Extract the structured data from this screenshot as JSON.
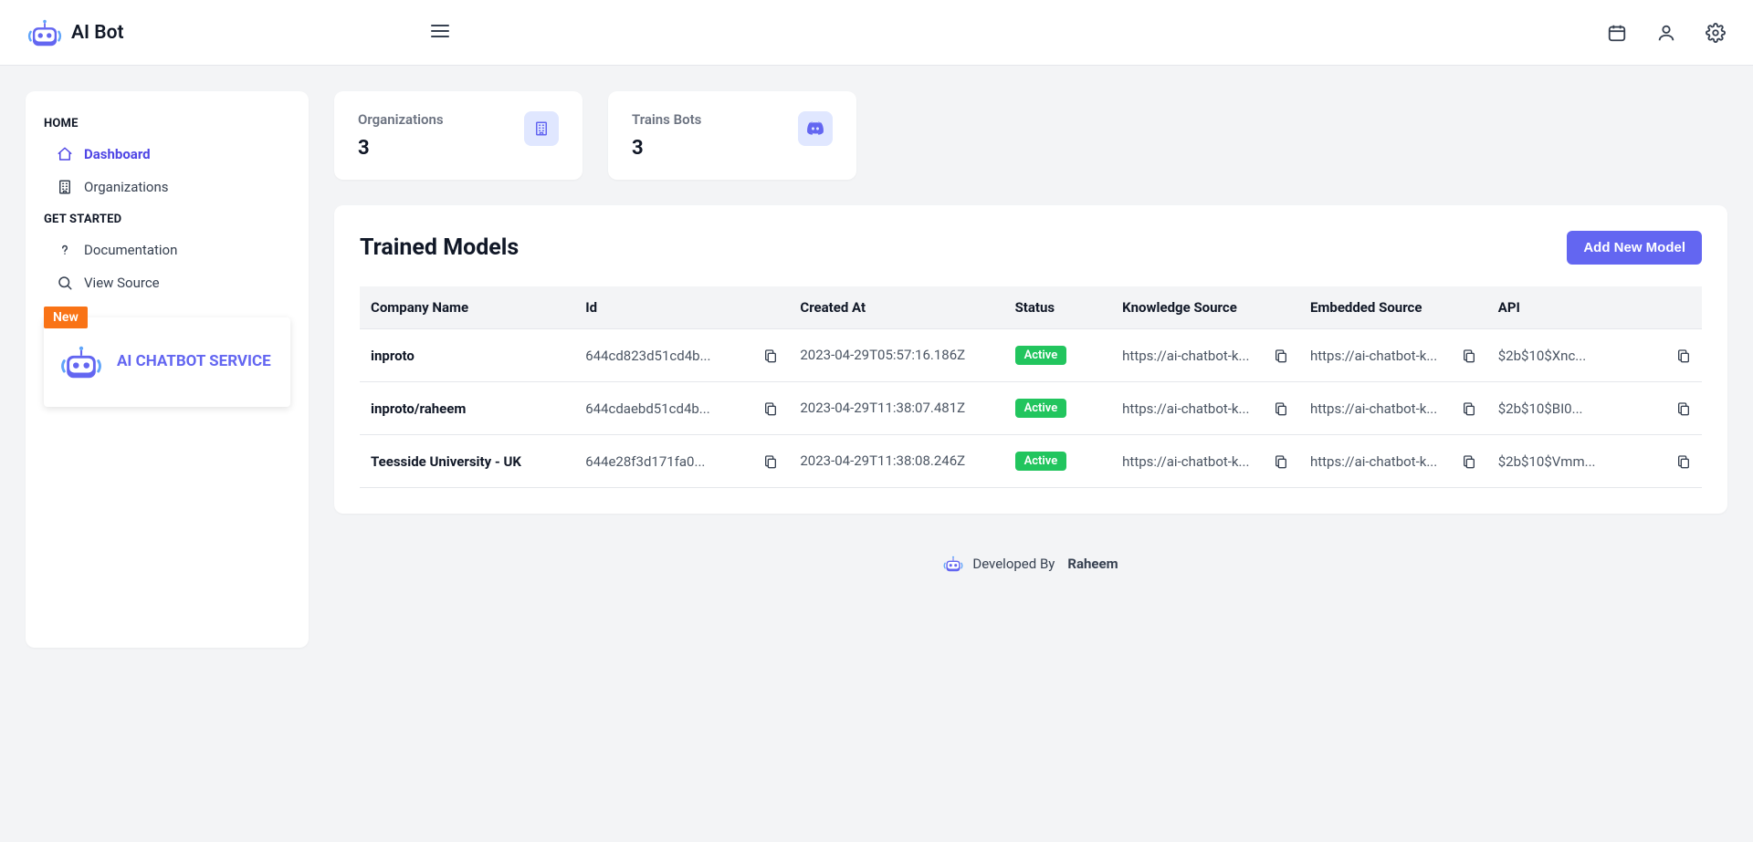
{
  "brand": "AI Bot",
  "sidebar": {
    "sections": [
      {
        "title": "HOME",
        "items": [
          {
            "label": "Dashboard",
            "icon": "home-icon",
            "active": true
          },
          {
            "label": "Organizations",
            "icon": "building-icon",
            "active": false
          }
        ]
      },
      {
        "title": "GET STARTED",
        "items": [
          {
            "label": "Documentation",
            "icon": "question-icon",
            "active": false
          },
          {
            "label": "View Source",
            "icon": "search-icon",
            "active": false
          }
        ]
      }
    ],
    "promo": {
      "badge": "New",
      "title": "AI CHATBOT SERVICE"
    }
  },
  "stats": [
    {
      "label": "Organizations",
      "value": "3",
      "icon": "building-icon"
    },
    {
      "label": "Trains Bots",
      "value": "3",
      "icon": "discord-icon"
    }
  ],
  "table": {
    "title": "Trained Models",
    "add_button": "Add New Model",
    "columns": [
      "Company Name",
      "Id",
      "Created At",
      "Status",
      "Knowledge Source",
      "Embedded Source",
      "API"
    ],
    "rows": [
      {
        "company": "inproto",
        "id": "644cd823d51cd4b...",
        "created": "2023-04-29T05:57:16.186Z",
        "status": "Active",
        "knowledge": "https://ai-chatbot-k...",
        "embedded": "https://ai-chatbot-k...",
        "api": "$2b$10$Xnc..."
      },
      {
        "company": "inproto/raheem",
        "id": "644cdaebd51cd4b...",
        "created": "2023-04-29T11:38:07.481Z",
        "status": "Active",
        "knowledge": "https://ai-chatbot-k...",
        "embedded": "https://ai-chatbot-k...",
        "api": "$2b$10$BI0..."
      },
      {
        "company": "Teesside University - UK",
        "id": "644e28f3d171fa0...",
        "created": "2023-04-29T11:38:08.246Z",
        "status": "Active",
        "knowledge": "https://ai-chatbot-k...",
        "embedded": "https://ai-chatbot-k...",
        "api": "$2b$10$Vmm..."
      }
    ]
  },
  "footer": {
    "text": "Developed By",
    "author": "Raheem"
  }
}
